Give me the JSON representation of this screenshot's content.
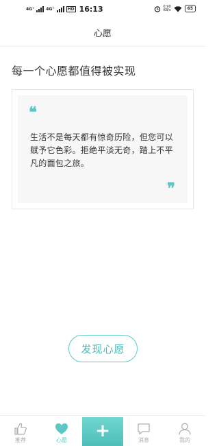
{
  "status_bar": {
    "net1": "4G⁺",
    "net2": "4G⁺",
    "hd": "HD",
    "time": "16:13",
    "speed_value": "0.90",
    "speed_unit": "KB/s",
    "battery": "65"
  },
  "header": {
    "title": "心愿"
  },
  "main": {
    "heading": "每一个心愿都值得被实现",
    "quote_open": "❝",
    "quote_text": "生活不是每天都有惊奇历险，但您可以赋予它色彩。拒绝平淡无奇，踏上不平凡的面包之旅。",
    "quote_close": "❞",
    "discover_label": "发现心愿"
  },
  "nav": {
    "items": [
      {
        "label": "推荐",
        "icon": "thumbs-up-icon"
      },
      {
        "label": "心愿",
        "icon": "heart-icon"
      },
      {
        "label": "+",
        "icon": "plus-icon"
      },
      {
        "label": "消息",
        "icon": "message-icon"
      },
      {
        "label": "我的",
        "icon": "user-icon"
      }
    ],
    "active": "心愿"
  },
  "colors": {
    "accent": "#5cc8c3",
    "inactive": "#aaaaaa"
  }
}
